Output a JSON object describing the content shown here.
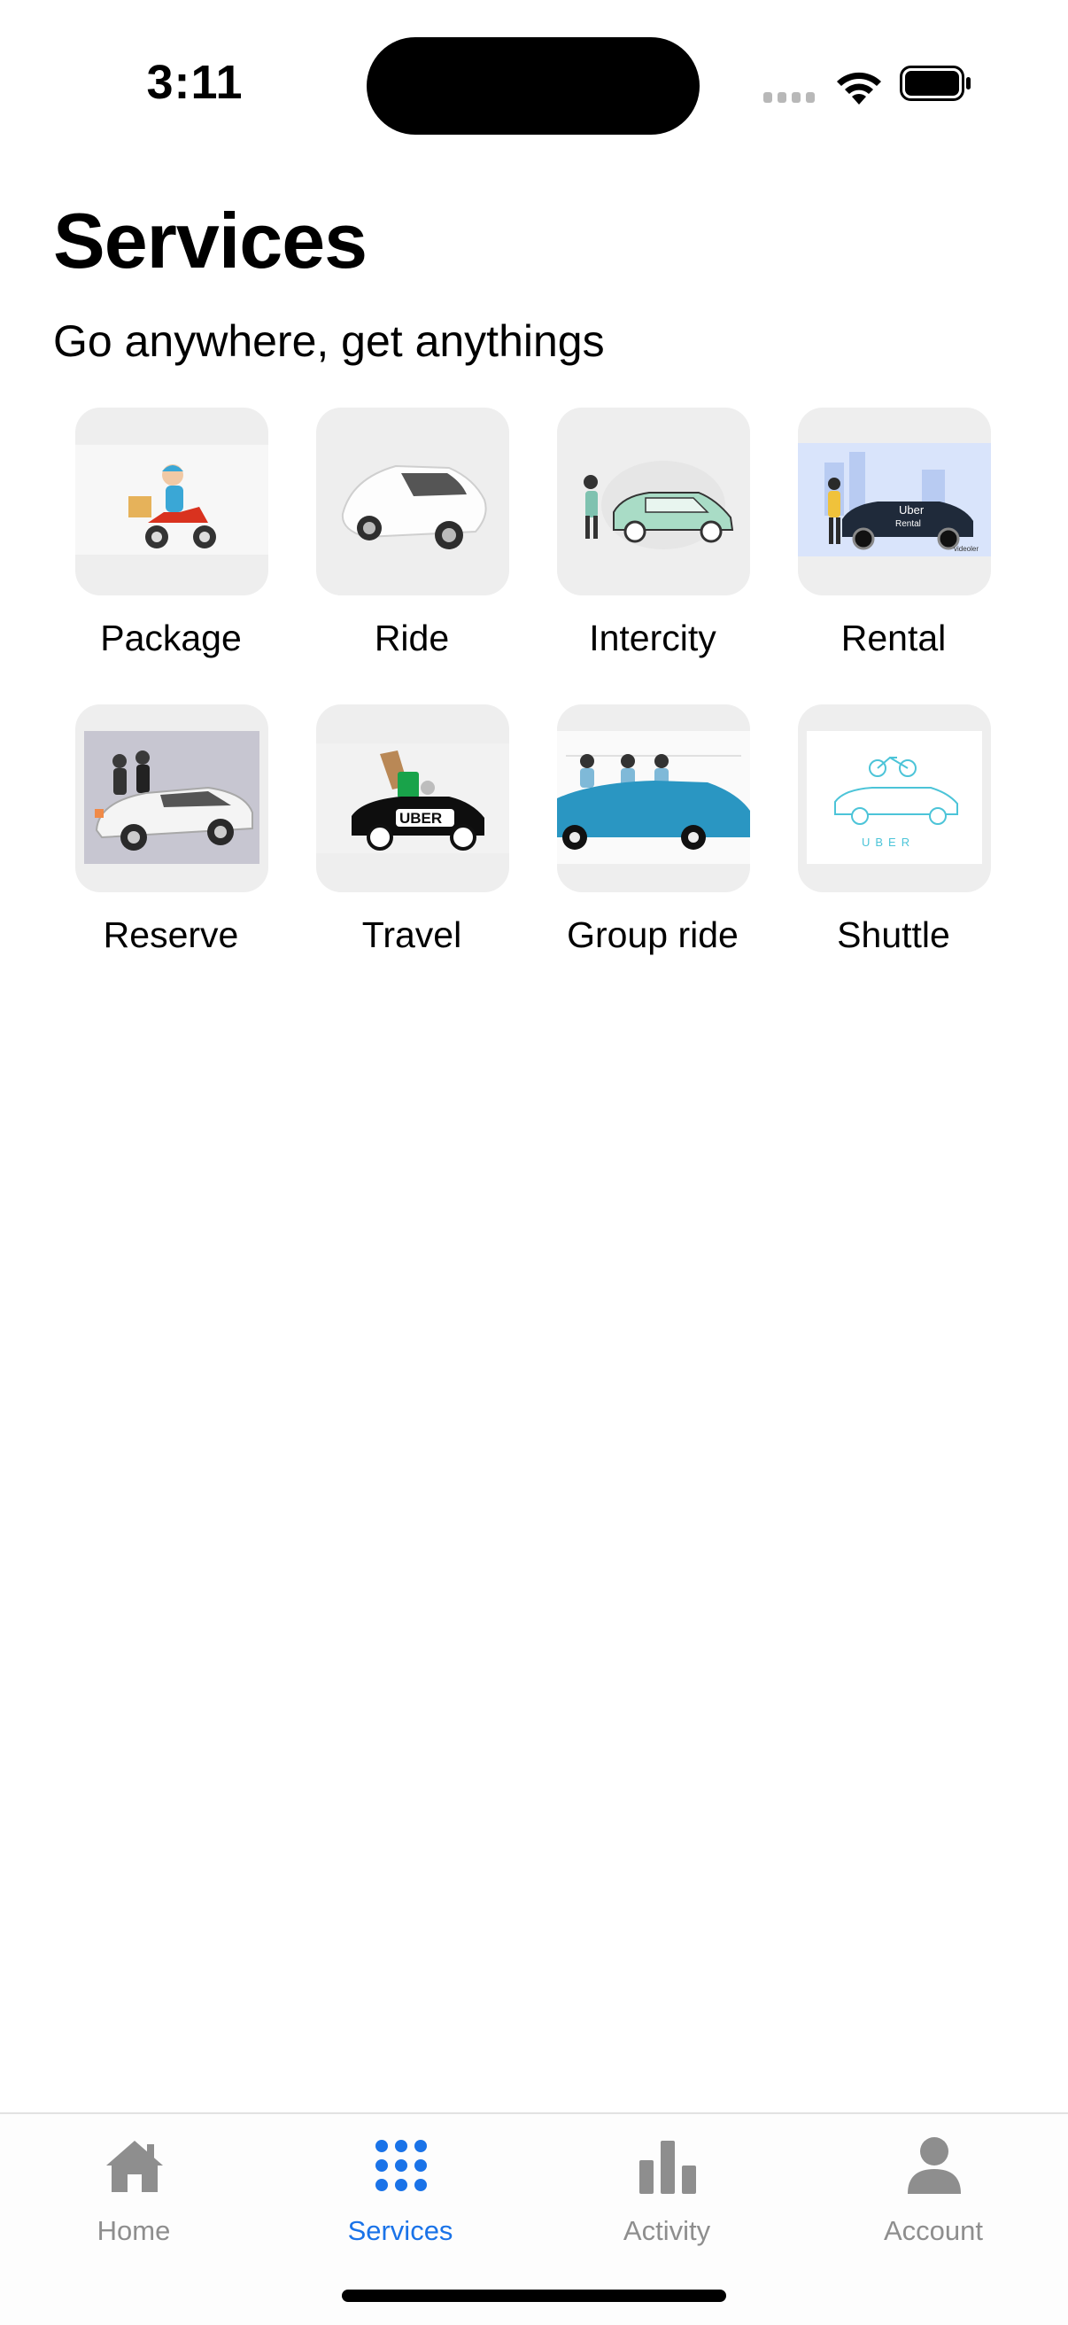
{
  "status_bar": {
    "time": "3:11"
  },
  "header": {
    "title": "Services",
    "subtitle": "Go anywhere, get anythings"
  },
  "services": [
    {
      "label": "Package",
      "icon": "package-scooter-icon"
    },
    {
      "label": "Ride",
      "icon": "white-car-icon"
    },
    {
      "label": "Intercity",
      "icon": "intercity-car-icon"
    },
    {
      "label": "Rental",
      "icon": "rental-car-icon"
    },
    {
      "label": "Reserve",
      "icon": "reserve-car-icon"
    },
    {
      "label": "Travel",
      "icon": "uber-taxi-icon"
    },
    {
      "label": "Group ride",
      "icon": "group-ride-car-icon"
    },
    {
      "label": "Shuttle",
      "icon": "shuttle-car-icon"
    }
  ],
  "rental_image_text": {
    "line1": "Uber",
    "line2": "Rental",
    "credit": "videoler"
  },
  "travel_image_text": "UBER",
  "shuttle_image_text": "UBER",
  "tabs": [
    {
      "label": "Home",
      "icon": "house-icon",
      "active": false
    },
    {
      "label": "Services",
      "icon": "grid-dots-icon",
      "active": true
    },
    {
      "label": "Activity",
      "icon": "bar-chart-icon",
      "active": false
    },
    {
      "label": "Account",
      "icon": "person-icon",
      "active": false
    }
  ],
  "colors": {
    "accent": "#1a73e8",
    "inactive_tab": "#8e8e8e",
    "tile_background": "#eeeeee"
  }
}
